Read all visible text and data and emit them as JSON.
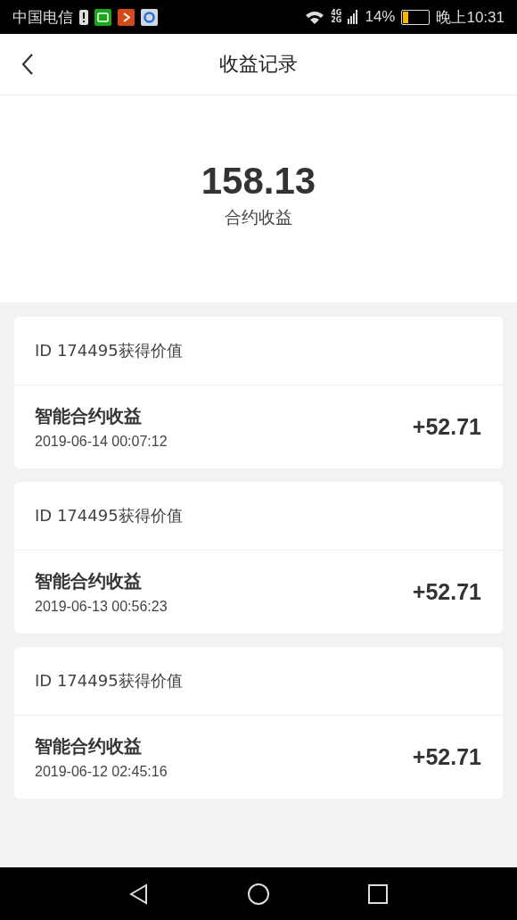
{
  "status_bar": {
    "carrier": "中国电信",
    "network_top": "4G",
    "network_bottom": "2G",
    "battery_text": "14%",
    "time": "晚上10:31"
  },
  "header": {
    "title": "收益记录"
  },
  "summary": {
    "amount": "158.13",
    "label": "合约收益"
  },
  "records": [
    {
      "source": "ID 174495获得价值",
      "name": "智能合约收益",
      "time": "2019-06-14 00:07:12",
      "amount": "+52.71"
    },
    {
      "source": "ID 174495获得价值",
      "name": "智能合约收益",
      "time": "2019-06-13 00:56:23",
      "amount": "+52.71"
    },
    {
      "source": "ID 174495获得价值",
      "name": "智能合约收益",
      "time": "2019-06-12 02:45:16",
      "amount": "+52.71"
    }
  ]
}
